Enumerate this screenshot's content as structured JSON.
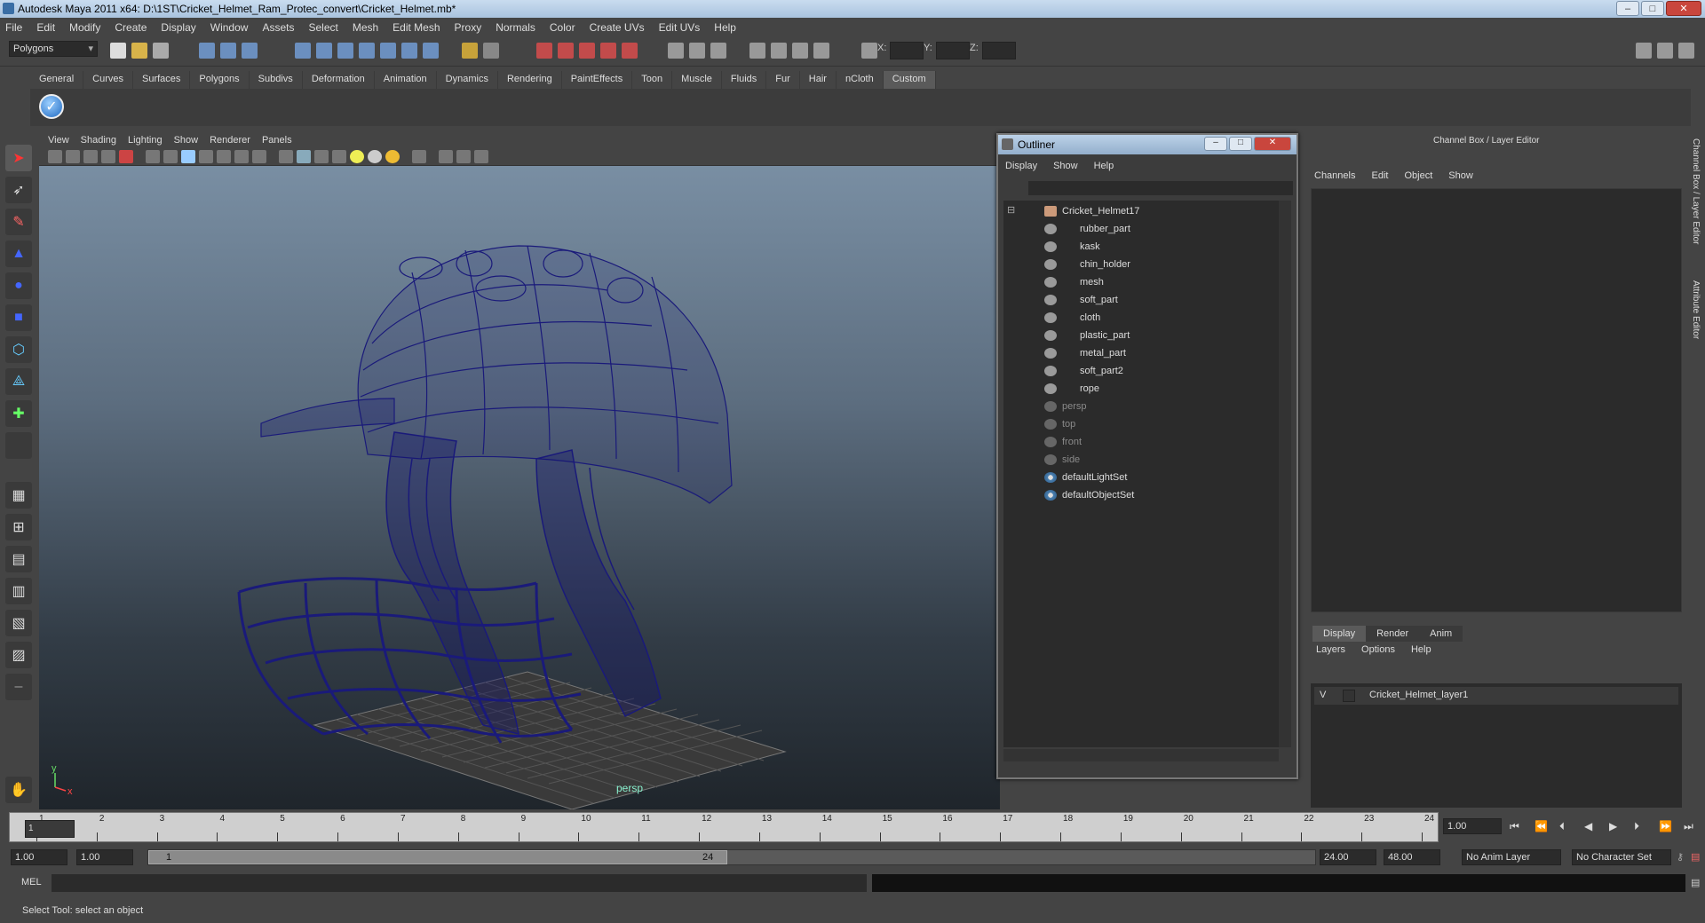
{
  "window": {
    "title": "Autodesk Maya 2011 x64: D:\\1ST\\Cricket_Helmet_Ram_Protec_convert\\Cricket_Helmet.mb*",
    "min": "–",
    "max": "□",
    "close": "✕"
  },
  "menubar": [
    "File",
    "Edit",
    "Modify",
    "Create",
    "Display",
    "Window",
    "Assets",
    "Select",
    "Mesh",
    "Edit Mesh",
    "Proxy",
    "Normals",
    "Color",
    "Create UVs",
    "Edit UVs",
    "Help"
  ],
  "status": {
    "mode": "Polygons",
    "x_label": "X:",
    "y_label": "Y:",
    "z_label": "Z:"
  },
  "shelf_tabs": [
    "General",
    "Curves",
    "Surfaces",
    "Polygons",
    "Subdivs",
    "Deformation",
    "Animation",
    "Dynamics",
    "Rendering",
    "PaintEffects",
    "Toon",
    "Muscle",
    "Fluids",
    "Fur",
    "Hair",
    "nCloth",
    "Custom"
  ],
  "shelf_active": "Custom",
  "viewport": {
    "menu": [
      "View",
      "Shading",
      "Lighting",
      "Show",
      "Renderer",
      "Panels"
    ],
    "camera_label": "persp",
    "axis_y": "y",
    "axis_x": "x",
    "wire_color": "#1a1a7a"
  },
  "outliner": {
    "title": "Outliner",
    "menu": [
      "Display",
      "Show",
      "Help"
    ],
    "items": [
      {
        "label": "Cricket_Helmet17",
        "type": "group",
        "dim": false
      },
      {
        "label": "rubber_part",
        "type": "mesh",
        "dim": false
      },
      {
        "label": "kask",
        "type": "mesh",
        "dim": false
      },
      {
        "label": "chin_holder",
        "type": "mesh",
        "dim": false
      },
      {
        "label": "mesh",
        "type": "mesh",
        "dim": false
      },
      {
        "label": "soft_part",
        "type": "mesh",
        "dim": false
      },
      {
        "label": "cloth",
        "type": "mesh",
        "dim": false
      },
      {
        "label": "plastic_part",
        "type": "mesh",
        "dim": false
      },
      {
        "label": "metal_part",
        "type": "mesh",
        "dim": false
      },
      {
        "label": "soft_part2",
        "type": "mesh",
        "dim": false
      },
      {
        "label": "rope",
        "type": "mesh",
        "dim": false
      },
      {
        "label": "persp",
        "type": "camera",
        "dim": true
      },
      {
        "label": "top",
        "type": "camera",
        "dim": true
      },
      {
        "label": "front",
        "type": "camera",
        "dim": true
      },
      {
        "label": "side",
        "type": "camera",
        "dim": true
      },
      {
        "label": "defaultLightSet",
        "type": "set",
        "dim": false
      },
      {
        "label": "defaultObjectSet",
        "type": "set",
        "dim": false
      }
    ]
  },
  "channelbox": {
    "title": "Channel Box / Layer Editor",
    "menu": [
      "Channels",
      "Edit",
      "Object",
      "Show"
    ],
    "layer_tabs": [
      "Display",
      "Render",
      "Anim"
    ],
    "layer_menu": [
      "Layers",
      "Options",
      "Help"
    ],
    "layer": {
      "visible": "V",
      "name": "Cricket_Helmet_layer1"
    }
  },
  "side_tabs": [
    "Channel Box / Layer Editor",
    "Attribute Editor"
  ],
  "timeline": {
    "ticks": [
      "1",
      "2",
      "3",
      "4",
      "5",
      "6",
      "7",
      "8",
      "9",
      "10",
      "11",
      "12",
      "13",
      "14",
      "15",
      "16",
      "17",
      "18",
      "19",
      "20",
      "21",
      "22",
      "23",
      "24"
    ],
    "current_marker": "1",
    "current_frame": "1.00"
  },
  "range": {
    "start": "1.00",
    "playback_start": "1.00",
    "slider_start": "1",
    "slider_end": "24",
    "playback_end": "24.00",
    "end": "48.00",
    "anim_layer": "No Anim Layer",
    "char_set": "No Character Set"
  },
  "command": {
    "label": "MEL"
  },
  "help": "Select Tool: select an object"
}
